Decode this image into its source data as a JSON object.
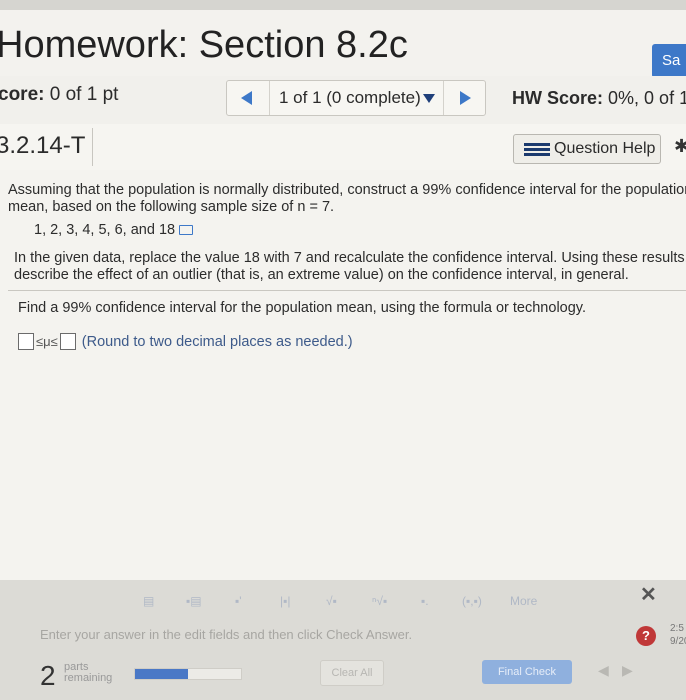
{
  "header": {
    "title": "Homework: Section 8.2c",
    "save_label": "Sa"
  },
  "score": {
    "label": "core:",
    "value": "0 of 1 pt",
    "nav_text": "1 of 1 (0 complete)",
    "hw_label": "HW Score:",
    "hw_value": "0%, 0 of 1"
  },
  "question": {
    "id": "3.2.14-T",
    "help_label": "Question Help",
    "instruction_line1": "Assuming that the population is normally distributed, construct a 99% confidence interval for the population",
    "instruction_line2": "mean, based on the following sample size of n = 7.",
    "data": "1, 2, 3, 4, 5, 6, and 18",
    "para_line1": "In the given data, replace the value 18 with 7 and recalculate the confidence interval. Using these results,",
    "para_line2": "describe the effect of an outlier (that is, an extreme value) on the confidence interval, in general.",
    "find_text": "Find a 99% confidence interval for the population mean, using the formula or technology.",
    "answer_symbol": "≤μ≤",
    "answer_note": "(Round to two decimal places as needed.)"
  },
  "toolbar": {
    "more_label": "More",
    "hint": "Enter your answer in the edit fields and then click Check Answer.",
    "help": "?",
    "time": "2:5",
    "date": "9/20",
    "parts_count": "2",
    "parts_label1": "parts",
    "parts_label2": "remaining",
    "clear_label": "Clear All",
    "final_label": "Final Check"
  },
  "progress_fraction": 0.5,
  "colors": {
    "accent": "#3d78c8",
    "help_red": "#c03838"
  }
}
